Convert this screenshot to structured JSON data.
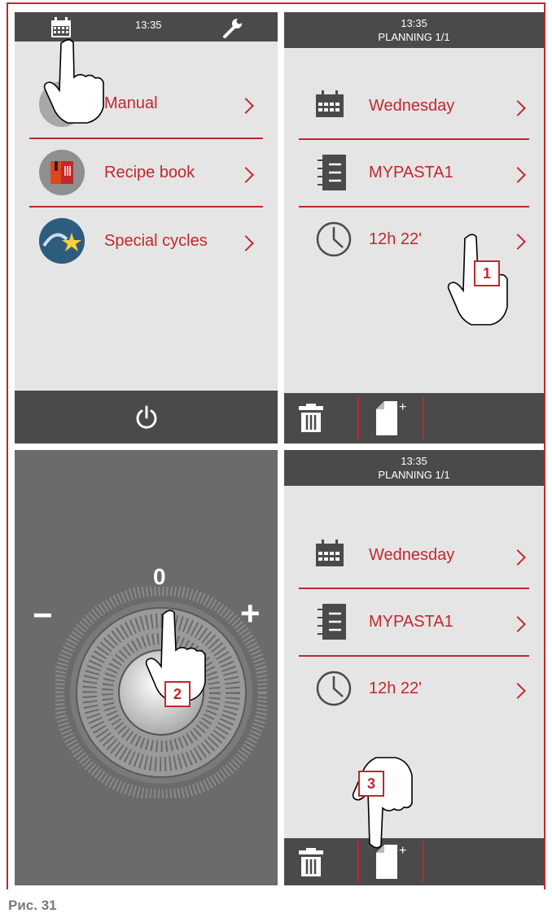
{
  "figure_caption": "Рис. 31",
  "panel1": {
    "time": "13:35",
    "icons": {
      "calendar": "calendar-icon",
      "settings": "wrench-icon",
      "power": "power-icon"
    },
    "menu": [
      {
        "label": "Manual",
        "icon": "manual-icon"
      },
      {
        "label": "Recipe book",
        "icon": "recipe-book-icon"
      },
      {
        "label": "Special cycles",
        "icon": "special-cycles-icon"
      }
    ]
  },
  "panel2": {
    "time": "13:35",
    "title": "PLANNING 1/1",
    "items": [
      {
        "label": "Wednesday",
        "icon": "calendar-icon"
      },
      {
        "label": "MYPASTA1",
        "icon": "list-icon"
      },
      {
        "label": "12h 22'",
        "icon": "clock-icon"
      }
    ],
    "step_badge": "1"
  },
  "panel3": {
    "zero_label": "0",
    "minus_label": "−",
    "plus_label": "+",
    "step_badge": "2"
  },
  "panel4": {
    "time": "13:35",
    "title": "PLANNING 1/1",
    "items": [
      {
        "label": "Wednesday",
        "icon": "calendar-icon"
      },
      {
        "label": "MYPASTA1",
        "icon": "list-icon"
      },
      {
        "label": "12h 22'",
        "icon": "clock-icon"
      }
    ],
    "step_badge": "3"
  },
  "colors": {
    "accent": "#c0282d",
    "bar": "#4a4a4a",
    "screen": "#e5e5e5",
    "dial_bg": "#6b6b6d"
  }
}
